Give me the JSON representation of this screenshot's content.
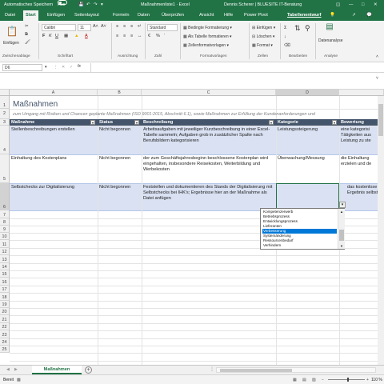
{
  "titlebar": {
    "autosave_label": "Automatisches Speichern",
    "autosave_state": "Aus",
    "filename": "Maßnahmenliste1 · Excel",
    "user": "Dennis Scherer | BLUESITE IT-Beratung",
    "context_tab": "Tabellentools"
  },
  "tabs": [
    "Datei",
    "Start",
    "Einfügen",
    "Seitenlayout",
    "Formeln",
    "Daten",
    "Überprüfen",
    "Ansicht",
    "Hilfe",
    "Power Pivot",
    "Tabellenentwurf"
  ],
  "active_tab": "Start",
  "ribbon": {
    "paste": "Einfügen",
    "font_name": "Calibri",
    "font_size": "11",
    "number_format": "Standard",
    "cond_format": "Bedingte Formatierung",
    "as_table": "Als Tabelle formatieren",
    "cell_styles": "Zellenformatvorlagen",
    "insert": "Einfügen",
    "delete": "Löschen",
    "format": "Format",
    "data_analysis": "Datenanalyse",
    "groups": [
      "Zwischenablage",
      "Schriftart",
      "Ausrichtung",
      "Zahl",
      "Formatvorlagen",
      "Zellen",
      "Bearbeiten",
      "Analyse"
    ]
  },
  "formula_bar": {
    "name_box": "D6",
    "fx": "fx",
    "content": ""
  },
  "columns": [
    "A",
    "B",
    "C",
    "D"
  ],
  "rows": [
    "1",
    "2",
    "3",
    "4",
    "5",
    "6",
    "7",
    "8",
    "9",
    "10",
    "11",
    "12",
    "13",
    "14",
    "15",
    "16",
    "17",
    "18",
    "19",
    "20",
    "21",
    "22",
    "23",
    "24",
    "25"
  ],
  "sheet": {
    "title": "Maßnahmen",
    "subtitle": "zum Umgang mit Risiken und Chancen geplante Maßnahmen (ISO 9001:2015, Abschnitt 6.1), sowie Maßnahmen zur Erfüllung der Kundenanforderungen und",
    "headers": [
      "Maßnahme",
      "Status",
      "Beschreibung",
      "Kategorie",
      "Bewertung"
    ],
    "rows": [
      [
        "Stellenbeschreibungen erstellen",
        "Nicht begonnen",
        "Arbeitsaufgaben mit jeweiliger Kurzbeschreibung in einer Excel-Tabelle sammeln; Aufgaben grob in zusätzlicher Spalte nach Berufsbildern kategorisieren",
        "Leistungssteigerung",
        "eine kategorisi Tätigkeiten aus Leistung zu ste"
      ],
      [
        "Einhaltung des Kostenplans",
        "Nicht begonnen",
        "der zum Geschäftsjahresbeginn beschlossene Kostenplan wird eingehalten, insbesondere Reisekosten, Weiterbildung und Werbekosten",
        "Überwachung/Messung",
        "die Einhaltung erzielen und de"
      ],
      [
        "Selbstchecks zur Digitalisierung",
        "Nicht begonnen",
        "Feststellen und dokumentieren des Stands der Digitalisierung mit Selbstchecks bei IHK's; Ergebnisse hier an der Maßnahme als Datei anfügen",
        "",
        "das kostenlose Ergebnis selbst"
      ]
    ]
  },
  "dropdown": {
    "options": [
      "Kompetenzerwerb",
      "Betriebsprozess",
      "Entwicklungsprozess",
      "Lieferanten",
      "Verbesserung",
      "Systemänderung",
      "Ressourcenbedarf",
      "Verhindern"
    ],
    "selected": "Verbesserung"
  },
  "sheet_tab": "Maßnahmen",
  "status": {
    "ready": "Bereit",
    "zoom": "110 %"
  },
  "colors": {
    "excel_green": "#217346",
    "header_fill": "#44546a",
    "band_fill": "#d9e1f2",
    "selection": "#0078d7"
  }
}
